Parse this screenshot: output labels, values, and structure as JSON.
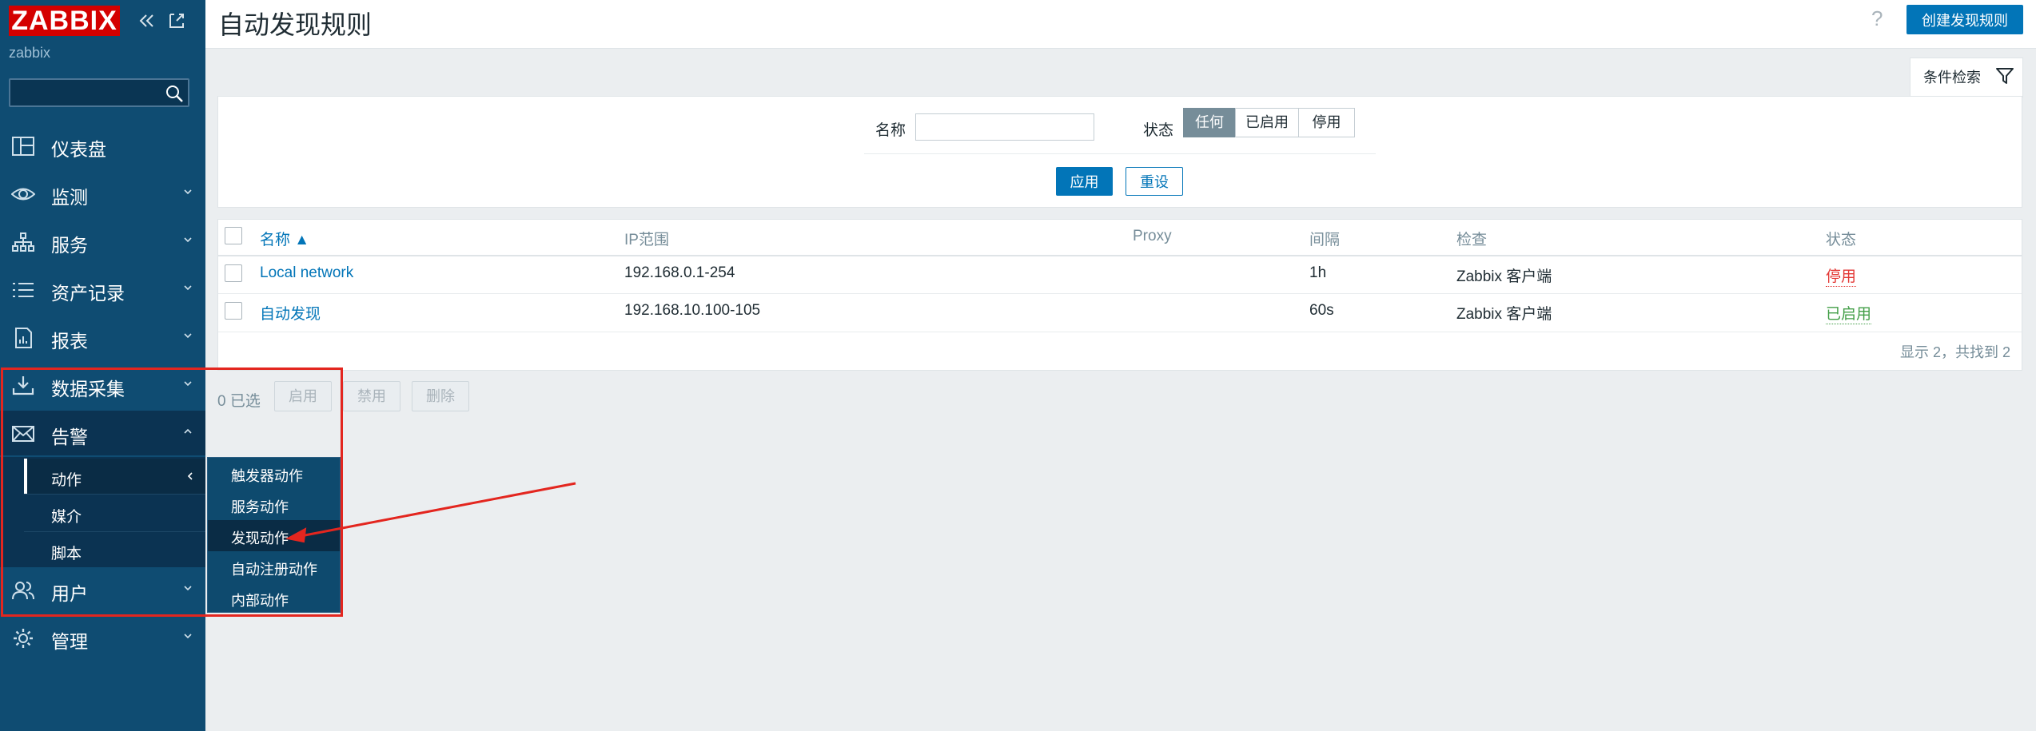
{
  "sidebar": {
    "logo": "ZABBIX",
    "user": "zabbix",
    "search_placeholder": "",
    "menu": [
      {
        "label": "仪表盘",
        "icon": "dashboard-icon"
      },
      {
        "label": "监测",
        "icon": "eye-icon"
      },
      {
        "label": "服务",
        "icon": "hierarchy-icon"
      },
      {
        "label": "资产记录",
        "icon": "list-icon"
      },
      {
        "label": "报表",
        "icon": "report-icon"
      },
      {
        "label": "数据采集",
        "icon": "download-icon"
      },
      {
        "label": "告警",
        "icon": "envelope-icon"
      },
      {
        "label": "用户",
        "icon": "users-icon"
      },
      {
        "label": "管理",
        "icon": "gear-icon"
      }
    ],
    "alerts_submenu": [
      "动作",
      "媒介",
      "脚本"
    ],
    "actions_flyout": [
      "触发器动作",
      "服务动作",
      "发现动作",
      "自动注册动作",
      "内部动作"
    ]
  },
  "header": {
    "title": "自动发现规则",
    "help": "?",
    "create_button": "创建发现规则"
  },
  "filter": {
    "tab_label": "条件检索",
    "name_label": "名称",
    "name_value": "",
    "status_label": "状态",
    "status_options": [
      "任何",
      "已启用",
      "停用"
    ],
    "status_selected": "任何",
    "apply": "应用",
    "reset": "重设"
  },
  "table": {
    "columns": [
      "名称 ▲",
      "IP范围",
      "Proxy",
      "间隔",
      "检查",
      "状态"
    ],
    "rows": [
      {
        "name": "Local network",
        "ip_range": "192.168.0.1-254",
        "proxy": "",
        "interval": "1h",
        "checks": "Zabbix 客户端",
        "status": "停用"
      },
      {
        "name": "自动发现",
        "ip_range": "192.168.10.100-105",
        "proxy": "",
        "interval": "60s",
        "checks": "Zabbix 客户端",
        "status": "已启用"
      }
    ],
    "summary": "显示 2，共找到 2"
  },
  "actions_bar": {
    "selected": "0 已选",
    "enable": "启用",
    "disable": "禁用",
    "delete": "删除"
  },
  "colors": {
    "sidebar_bg": "#0f4c72",
    "logo_red": "#d40000",
    "primary": "#0275b8",
    "status_disabled": "#e33734",
    "status_enabled": "#429e47",
    "annotation_red": "#e3261f"
  }
}
